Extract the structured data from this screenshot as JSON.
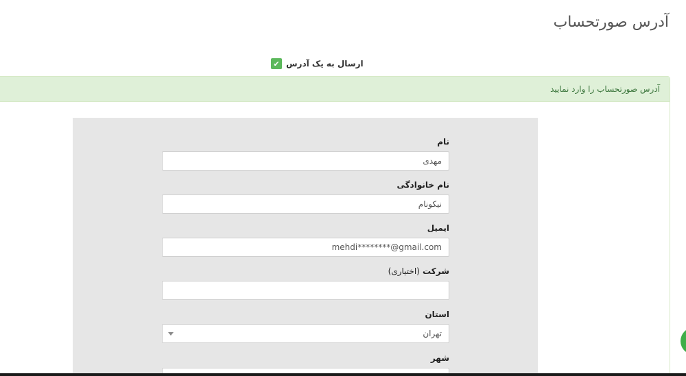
{
  "page": {
    "title": "آدرس صورتحساب"
  },
  "shipping": {
    "ship_to_one_label": "ارسال به یک آدرس",
    "checked": true
  },
  "panel": {
    "heading": "آدرس صورتحساب را وارد نمایید"
  },
  "form": {
    "first_name": {
      "label": "نام",
      "value": "مهدی"
    },
    "last_name": {
      "label": "نام خانوادگی",
      "value": "نیکونام"
    },
    "email": {
      "label": "ایمیل",
      "value": "mehdi********@gmail.com"
    },
    "company": {
      "label": "شرکت",
      "optional": "(اختیاری)",
      "value": ""
    },
    "province": {
      "label": "استان",
      "selected": "تهران"
    },
    "city": {
      "label": "شهر"
    }
  },
  "colors": {
    "accent_green": "#5cb85c",
    "panel_heading_bg": "#dff0d8",
    "form_bg": "#e6e6e6"
  },
  "icons": {
    "checkbox": "check-icon",
    "select": "caret-down-icon",
    "chat": "chat-bubble-icon"
  }
}
